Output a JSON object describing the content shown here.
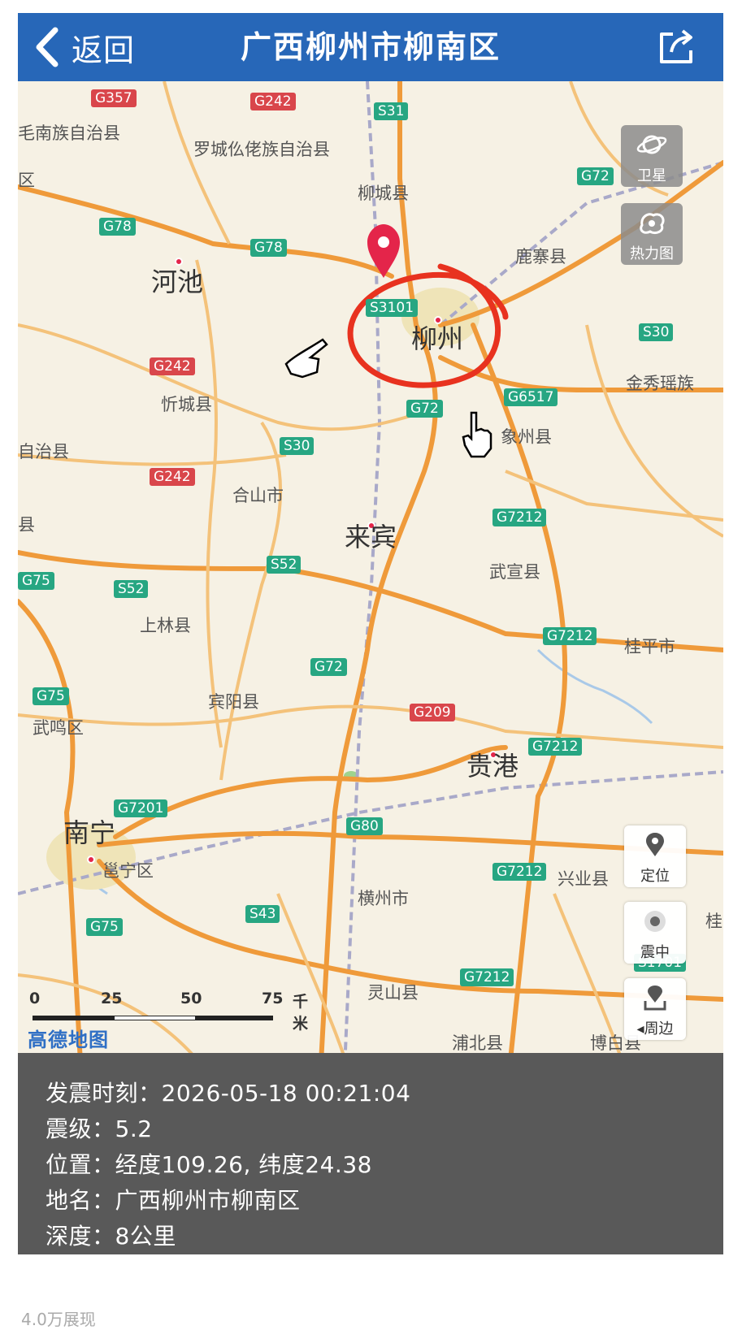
{
  "nav": {
    "back_label": "返回",
    "title": "广西柳州市柳南区"
  },
  "map": {
    "roads": {
      "highway_color": "#ef9a3a",
      "road_color": "#f4c27a",
      "rail_color": "#a9a9c9",
      "marker_color": "#e4254a",
      "circle_color": "#e8321f"
    },
    "shields": [
      {
        "code": "G357",
        "type": "r"
      },
      {
        "code": "G242",
        "type": "r"
      },
      {
        "code": "S31",
        "type": "g"
      },
      {
        "code": "G72",
        "type": "g"
      },
      {
        "code": "G78",
        "type": "g"
      },
      {
        "code": "G78",
        "type": "g"
      },
      {
        "code": "S3101",
        "type": "g"
      },
      {
        "code": "S30",
        "type": "g"
      },
      {
        "code": "G242",
        "type": "r"
      },
      {
        "code": "G6517",
        "type": "g"
      },
      {
        "code": "G72",
        "type": "g"
      },
      {
        "code": "S30",
        "type": "g"
      },
      {
        "code": "G242",
        "type": "r"
      },
      {
        "code": "G7212",
        "type": "g"
      },
      {
        "code": "G75",
        "type": "g"
      },
      {
        "code": "S52",
        "type": "g"
      },
      {
        "code": "S52",
        "type": "g"
      },
      {
        "code": "G7212",
        "type": "g"
      },
      {
        "code": "G72",
        "type": "g"
      },
      {
        "code": "G75",
        "type": "g"
      },
      {
        "code": "G209",
        "type": "r"
      },
      {
        "code": "G7212",
        "type": "g"
      },
      {
        "code": "G7201",
        "type": "g"
      },
      {
        "code": "G80",
        "type": "g"
      },
      {
        "code": "G7212",
        "type": "g"
      },
      {
        "code": "G75",
        "type": "g"
      },
      {
        "code": "S43",
        "type": "g"
      },
      {
        "code": "G7212",
        "type": "g"
      },
      {
        "code": "S1701",
        "type": "g"
      }
    ],
    "places": [
      "毛南族自治县",
      "罗城仫佬族自治县",
      "区",
      "柳城县",
      "鹿寨县",
      "忻城县",
      "自治县",
      "金秀瑶族",
      "象州县",
      "合山市",
      "县",
      "武宣县",
      "上林县",
      "桂平市",
      "宾阳县",
      "武鸣区",
      "邕宁区",
      "兴业县",
      "横州市",
      "灵山县",
      "浦北县",
      "博白县",
      "桂"
    ],
    "cities": [
      "河池",
      "柳州",
      "来宾",
      "贵港",
      "南宁"
    ],
    "buttons": {
      "satellite": "卫星",
      "heatmap": "热力图",
      "locate": "定位",
      "epicenter": "震中",
      "nearby": "周边"
    },
    "scale": {
      "ticks": [
        "0",
        "25",
        "50",
        "75"
      ],
      "unit": "千米"
    },
    "logo": "高德地图"
  },
  "info": {
    "time_label": "发震时刻：",
    "time_value": "2026-05-18 00:21:04",
    "mag_label": "震级：",
    "mag_value": "5.2",
    "loc_label": "位置：",
    "loc_value": "经度109.26, 纬度24.38",
    "name_label": "地名：",
    "name_value": "广西柳州市柳南区",
    "depth_label": "深度：",
    "depth_value": "8公里"
  },
  "footer": "4.0万展现"
}
